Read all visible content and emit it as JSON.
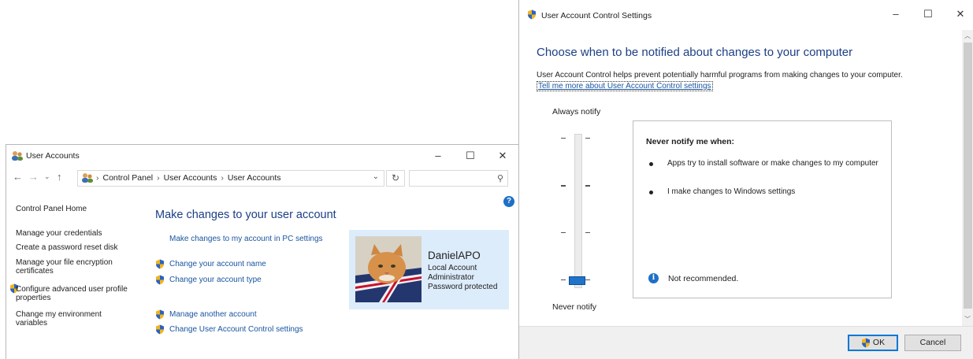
{
  "user_accounts": {
    "window_title": "User Accounts",
    "breadcrumb": [
      "Control Panel",
      "User Accounts",
      "User Accounts"
    ],
    "search_placeholder": "",
    "help_label": "?",
    "sidebar": {
      "home": "Control Panel Home",
      "links": [
        "Manage your credentials",
        "Create a password reset disk",
        "Manage your file encryption certificates",
        "Configure advanced user profile properties",
        "Change my environment variables"
      ]
    },
    "heading": "Make changes to your user account",
    "pc_settings_link": "Make changes to my account in PC settings",
    "tasks": [
      "Change your account name",
      "Change your account type"
    ],
    "other_tasks": [
      "Manage another account",
      "Change User Account Control settings"
    ],
    "user": {
      "name": "DanielAPO",
      "lines": [
        "Local Account",
        "Administrator",
        "Password protected"
      ]
    }
  },
  "uac": {
    "window_title": "User Account Control Settings",
    "heading": "Choose when to be notified about changes to your computer",
    "description": "User Account Control helps prevent potentially harmful programs from making changes to your computer.",
    "learn_more": "Tell me more about User Account Control settings",
    "slider_top_label": "Always notify",
    "slider_bottom_label": "Never notify",
    "slider_level": "4 of 4 (bottom)",
    "panel_title": "Never notify me when:",
    "bullets": [
      "Apps try to install software or make changes to my computer",
      "I make changes to Windows settings"
    ],
    "info_icon_label": "i",
    "recommendation": "Not recommended.",
    "ok_label": "OK",
    "cancel_label": "Cancel"
  },
  "window_controls": {
    "minimize": "–",
    "maximize": "☐",
    "close": "✕"
  },
  "colors": {
    "link": "#1a55a0",
    "heading": "#1c3f85",
    "accent": "#0078d7",
    "user_card": "#dcecfa"
  }
}
